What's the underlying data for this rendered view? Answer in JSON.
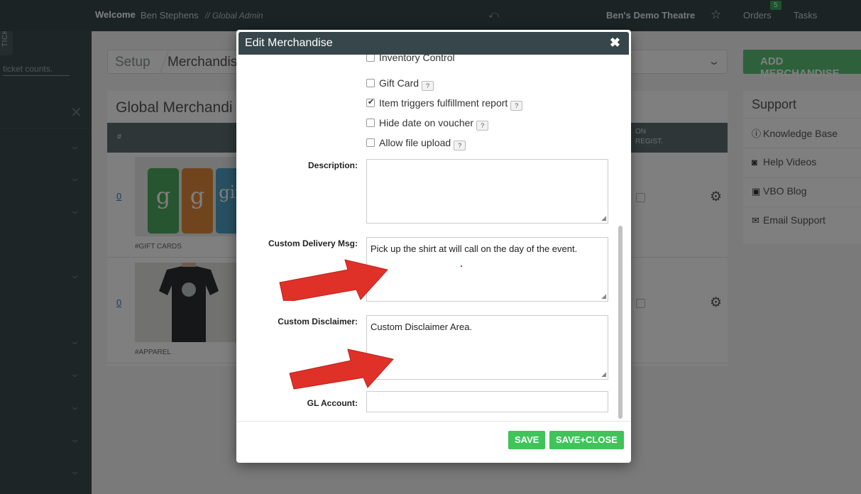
{
  "topbar": {
    "welcome": "Welcome",
    "user": "Ben Stephens",
    "role": "// Global Admin",
    "org": "Ben's Demo Theatre",
    "orders_label": "Orders",
    "orders_count": "5",
    "tasks_label": "Tasks"
  },
  "sidebar": {
    "tickets_tab": "TICKETS",
    "ticket_counts": "ticket counts."
  },
  "page": {
    "breadcrumb_setup": "Setup",
    "breadcrumb_current": "Merchandis",
    "add_button": "ADD MERCHANDISE",
    "panel_title": "Global Merchandi",
    "col_hash": "#",
    "col_on_register": "ON\nREGIST.",
    "rows": [
      {
        "num": "0",
        "tag": "#GIFT CARDS"
      },
      {
        "num": "0",
        "tag": "#APPAREL"
      }
    ],
    "gift_card_letters": [
      "g",
      "g",
      "gift"
    ]
  },
  "support": {
    "title": "Support",
    "items": [
      {
        "icon": "info-icon",
        "label": "Knowledge Base"
      },
      {
        "icon": "camera-icon",
        "label": "Help Videos"
      },
      {
        "icon": "rss-icon",
        "label": "VBO Blog"
      },
      {
        "icon": "envelope-icon",
        "label": "Email Support"
      }
    ]
  },
  "modal": {
    "title": "Edit Merchandise",
    "checkboxes": [
      {
        "label": "Inventory Control",
        "checked": false,
        "help": false
      },
      {
        "label": "Gift Card",
        "checked": false,
        "help": true
      },
      {
        "label": "Item triggers fulfillment report",
        "checked": true,
        "help": true
      },
      {
        "label": "Hide date on voucher",
        "checked": false,
        "help": true
      },
      {
        "label": "Allow file upload",
        "checked": false,
        "help": true
      }
    ],
    "help_glyph": "?",
    "description_label": "Description:",
    "description_value": "",
    "delivery_label": "Custom Delivery Msg:",
    "delivery_value": "Pick up the shirt at will call on the day of the event.",
    "disclaimer_label": "Custom Disclaimer:",
    "disclaimer_value": "Custom Disclaimer Area.",
    "gl_label": "GL Account:",
    "gl_value": "",
    "save_label": "SAVE",
    "save_close_label": "SAVE+CLOSE"
  },
  "colors": {
    "topbar": "#37464a",
    "accent_green": "#3fc45a",
    "arrow_red": "#e03128"
  }
}
